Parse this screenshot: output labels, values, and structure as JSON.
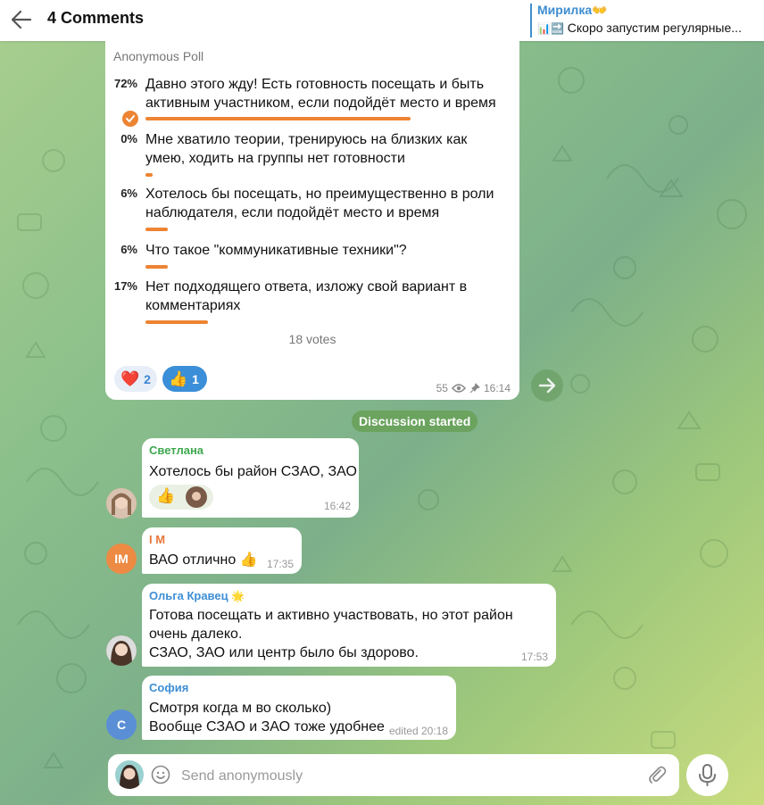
{
  "header": {
    "title": "4 Comments",
    "pinned_channel": "Мирилка",
    "pinned_channel_emoji": "👐",
    "pinned_emojis": "📊🔜",
    "pinned_text": "Скоро запустим регулярные..."
  },
  "poll": {
    "type_label": "Anonymous Poll",
    "options": [
      {
        "percent": "72%",
        "value": 72,
        "line1": "Давно этого жду! Есть готовность посещать и быть",
        "line2": "активным участником, если подойдёт место и время",
        "chosen": true
      },
      {
        "percent": "0%",
        "value": 0,
        "line1": "Мне хватило теории, тренируюсь на близких как",
        "line2": "умею, ходить на группы нет готовности",
        "chosen": false
      },
      {
        "percent": "6%",
        "value": 6,
        "line1": "Хотелось бы посещать, но преимущественно в роли",
        "line2": "наблюдателя, если подойдёт место и время",
        "chosen": false
      },
      {
        "percent": "6%",
        "value": 6,
        "line1": "Что такое \"коммуникативные техники\"?",
        "line2": "",
        "chosen": false
      },
      {
        "percent": "17%",
        "value": 17,
        "line1": "Нет подходящего ответа, изложу свой вариант в",
        "line2": "комментариях",
        "chosen": false
      }
    ],
    "votes": "18 votes",
    "reactions": [
      {
        "emoji": "❤️",
        "count": "2"
      },
      {
        "emoji": "👍",
        "count": "1"
      }
    ],
    "views": "55",
    "time": "16:14"
  },
  "discussion_label": "Discussion started",
  "comments": [
    {
      "author": "Светлана",
      "author_color": "#3fa84f",
      "text": "Хотелось бы район СЗАО, ЗАО",
      "reaction": "👍",
      "time": "16:42"
    },
    {
      "author": "I M",
      "author_color": "#e8763a",
      "avatar_initials": "IM",
      "avatar_color": "#ed8a43",
      "text": "ВАО отлично",
      "emoji": "👍",
      "time": "17:35"
    },
    {
      "author": "Ольга Кравец",
      "author_emoji": "🌟",
      "author_color": "#3e8ed6",
      "line1": "Готова посещать и активно участвовать, но этот район",
      "line2": "очень далеко.",
      "line3": "СЗАО, ЗАО или центр было бы здорово.",
      "time": "17:53"
    },
    {
      "author": "София",
      "author_color": "#3e8ed6",
      "avatar_initials": "С",
      "avatar_color": "#5a8fd6",
      "line1": "Смотря когда м во сколько)",
      "line2": "Вообще СЗАО и ЗАО тоже удобнее",
      "time": "edited 20:18"
    }
  ],
  "input": {
    "placeholder": "Send anonymously",
    "value": ""
  },
  "colors": {
    "accent": "#ed8433",
    "link": "#3e8dd0",
    "header_bg": "#ffffff"
  }
}
